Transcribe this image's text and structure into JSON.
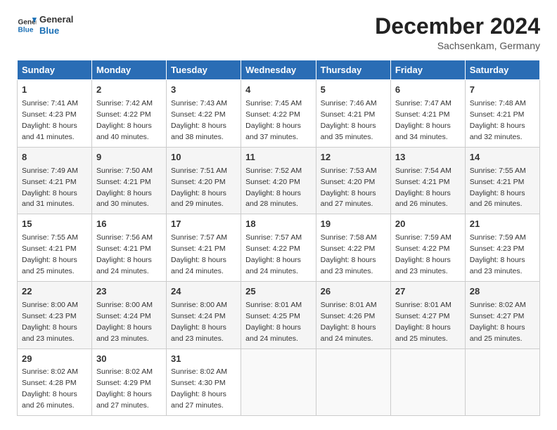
{
  "header": {
    "logo_line1": "General",
    "logo_line2": "Blue",
    "month": "December 2024",
    "location": "Sachsenkam, Germany"
  },
  "weekdays": [
    "Sunday",
    "Monday",
    "Tuesday",
    "Wednesday",
    "Thursday",
    "Friday",
    "Saturday"
  ],
  "weeks": [
    [
      {
        "day": "1",
        "sunrise": "7:41 AM",
        "sunset": "4:23 PM",
        "daylight": "8 hours and 41 minutes."
      },
      {
        "day": "2",
        "sunrise": "7:42 AM",
        "sunset": "4:22 PM",
        "daylight": "8 hours and 40 minutes."
      },
      {
        "day": "3",
        "sunrise": "7:43 AM",
        "sunset": "4:22 PM",
        "daylight": "8 hours and 38 minutes."
      },
      {
        "day": "4",
        "sunrise": "7:45 AM",
        "sunset": "4:22 PM",
        "daylight": "8 hours and 37 minutes."
      },
      {
        "day": "5",
        "sunrise": "7:46 AM",
        "sunset": "4:21 PM",
        "daylight": "8 hours and 35 minutes."
      },
      {
        "day": "6",
        "sunrise": "7:47 AM",
        "sunset": "4:21 PM",
        "daylight": "8 hours and 34 minutes."
      },
      {
        "day": "7",
        "sunrise": "7:48 AM",
        "sunset": "4:21 PM",
        "daylight": "8 hours and 32 minutes."
      }
    ],
    [
      {
        "day": "8",
        "sunrise": "7:49 AM",
        "sunset": "4:21 PM",
        "daylight": "8 hours and 31 minutes."
      },
      {
        "day": "9",
        "sunrise": "7:50 AM",
        "sunset": "4:21 PM",
        "daylight": "8 hours and 30 minutes."
      },
      {
        "day": "10",
        "sunrise": "7:51 AM",
        "sunset": "4:20 PM",
        "daylight": "8 hours and 29 minutes."
      },
      {
        "day": "11",
        "sunrise": "7:52 AM",
        "sunset": "4:20 PM",
        "daylight": "8 hours and 28 minutes."
      },
      {
        "day": "12",
        "sunrise": "7:53 AM",
        "sunset": "4:20 PM",
        "daylight": "8 hours and 27 minutes."
      },
      {
        "day": "13",
        "sunrise": "7:54 AM",
        "sunset": "4:21 PM",
        "daylight": "8 hours and 26 minutes."
      },
      {
        "day": "14",
        "sunrise": "7:55 AM",
        "sunset": "4:21 PM",
        "daylight": "8 hours and 26 minutes."
      }
    ],
    [
      {
        "day": "15",
        "sunrise": "7:55 AM",
        "sunset": "4:21 PM",
        "daylight": "8 hours and 25 minutes."
      },
      {
        "day": "16",
        "sunrise": "7:56 AM",
        "sunset": "4:21 PM",
        "daylight": "8 hours and 24 minutes."
      },
      {
        "day": "17",
        "sunrise": "7:57 AM",
        "sunset": "4:21 PM",
        "daylight": "8 hours and 24 minutes."
      },
      {
        "day": "18",
        "sunrise": "7:57 AM",
        "sunset": "4:22 PM",
        "daylight": "8 hours and 24 minutes."
      },
      {
        "day": "19",
        "sunrise": "7:58 AM",
        "sunset": "4:22 PM",
        "daylight": "8 hours and 23 minutes."
      },
      {
        "day": "20",
        "sunrise": "7:59 AM",
        "sunset": "4:22 PM",
        "daylight": "8 hours and 23 minutes."
      },
      {
        "day": "21",
        "sunrise": "7:59 AM",
        "sunset": "4:23 PM",
        "daylight": "8 hours and 23 minutes."
      }
    ],
    [
      {
        "day": "22",
        "sunrise": "8:00 AM",
        "sunset": "4:23 PM",
        "daylight": "8 hours and 23 minutes."
      },
      {
        "day": "23",
        "sunrise": "8:00 AM",
        "sunset": "4:24 PM",
        "daylight": "8 hours and 23 minutes."
      },
      {
        "day": "24",
        "sunrise": "8:00 AM",
        "sunset": "4:24 PM",
        "daylight": "8 hours and 23 minutes."
      },
      {
        "day": "25",
        "sunrise": "8:01 AM",
        "sunset": "4:25 PM",
        "daylight": "8 hours and 24 minutes."
      },
      {
        "day": "26",
        "sunrise": "8:01 AM",
        "sunset": "4:26 PM",
        "daylight": "8 hours and 24 minutes."
      },
      {
        "day": "27",
        "sunrise": "8:01 AM",
        "sunset": "4:27 PM",
        "daylight": "8 hours and 25 minutes."
      },
      {
        "day": "28",
        "sunrise": "8:02 AM",
        "sunset": "4:27 PM",
        "daylight": "8 hours and 25 minutes."
      }
    ],
    [
      {
        "day": "29",
        "sunrise": "8:02 AM",
        "sunset": "4:28 PM",
        "daylight": "8 hours and 26 minutes."
      },
      {
        "day": "30",
        "sunrise": "8:02 AM",
        "sunset": "4:29 PM",
        "daylight": "8 hours and 27 minutes."
      },
      {
        "day": "31",
        "sunrise": "8:02 AM",
        "sunset": "4:30 PM",
        "daylight": "8 hours and 27 minutes."
      },
      null,
      null,
      null,
      null
    ]
  ],
  "labels": {
    "sunrise": "Sunrise:",
    "sunset": "Sunset:",
    "daylight": "Daylight:"
  }
}
